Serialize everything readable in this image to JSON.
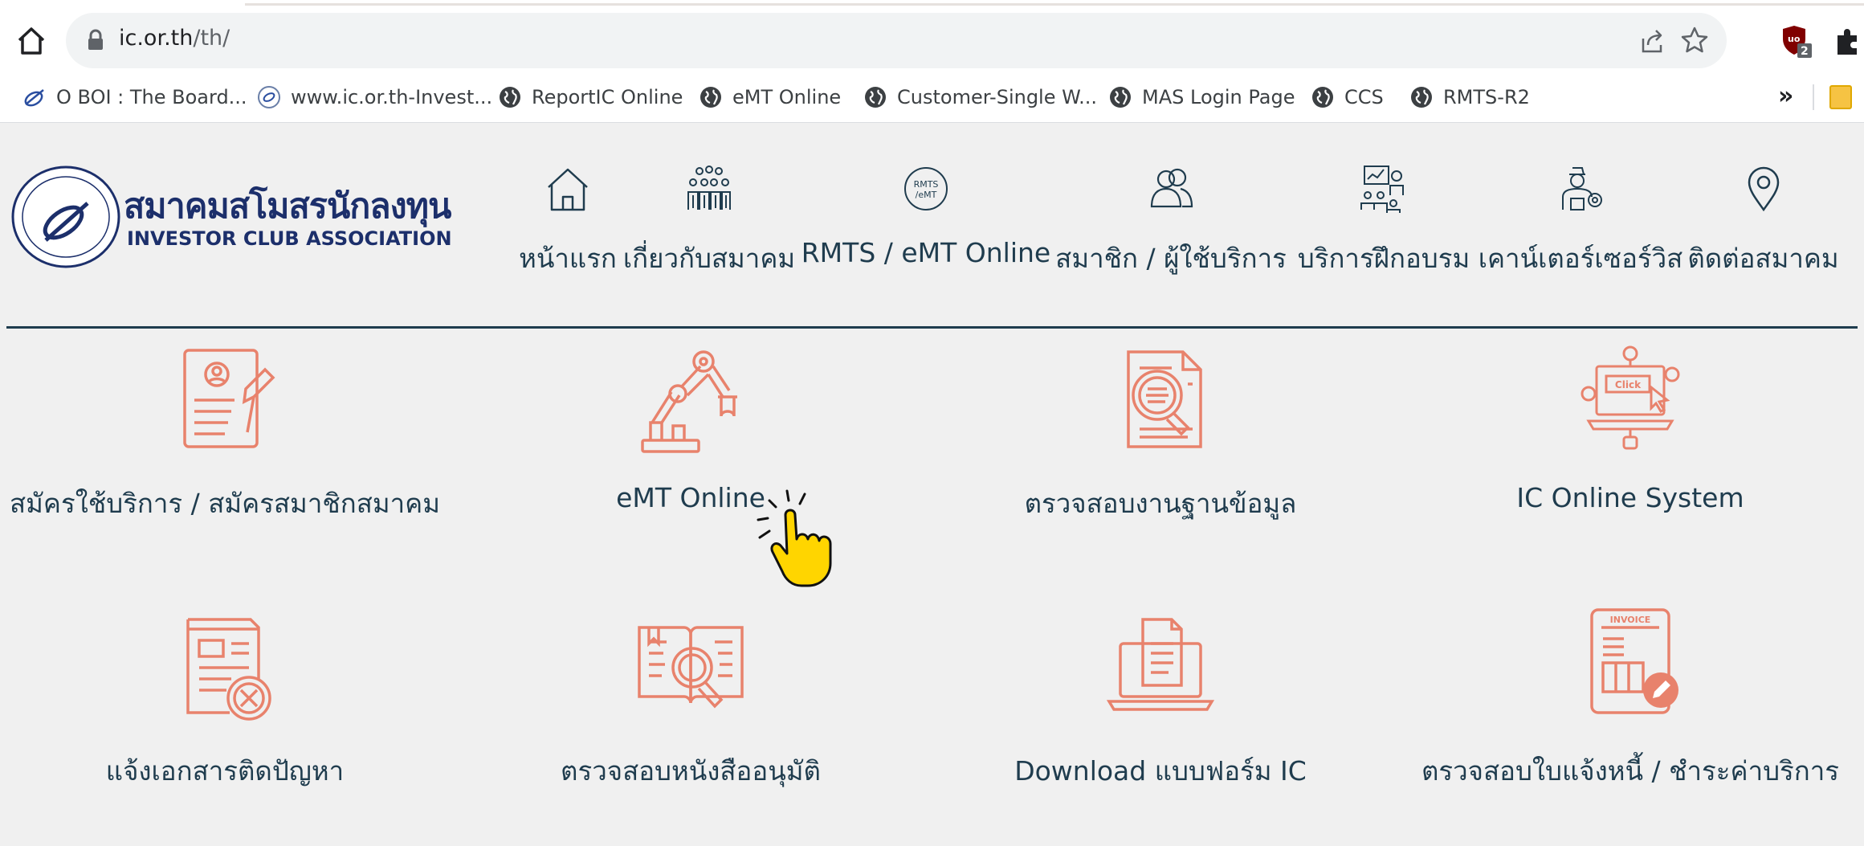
{
  "browser": {
    "url_domain": "ic.or.th",
    "url_path": "/th/",
    "extension_badge": "2",
    "bookmarks": [
      {
        "label": "O BOI : The Board...",
        "icon": "boi-icon"
      },
      {
        "label": "www.ic.or.th-Invest...",
        "icon": "ic-icon"
      },
      {
        "label": "ReportIC Online",
        "icon": "globe-icon"
      },
      {
        "label": "eMT Online",
        "icon": "globe-icon"
      },
      {
        "label": "Customer-Single W...",
        "icon": "globe-icon"
      },
      {
        "label": "MAS Login Page",
        "icon": "globe-icon"
      },
      {
        "label": "CCS",
        "icon": "globe-icon"
      },
      {
        "label": "RMTS-R2",
        "icon": "globe-icon"
      }
    ],
    "more_label": "»"
  },
  "site": {
    "logo_th": "สมาคมสโมสรนักลงทุน",
    "logo_en": "INVESTOR CLUB ASSOCIATION",
    "nav": [
      {
        "label": "หน้าแรก",
        "icon": "home-icon"
      },
      {
        "label": "เกี่ยวกับสมาคม",
        "icon": "people-group-icon"
      },
      {
        "label": "RMTS / eMT Online",
        "icon": "rmts-emt-icon",
        "icon_text": "RMTS /eMT"
      },
      {
        "label": "สมาชิก / ผู้ใช้บริการ",
        "icon": "members-icon"
      },
      {
        "label": "บริการฝึกอบรม",
        "icon": "training-icon"
      },
      {
        "label": "เคาน์เตอร์เซอร์วิส",
        "icon": "counter-service-icon"
      },
      {
        "label": "ติดต่อสมาคม",
        "icon": "location-pin-icon"
      }
    ],
    "services": [
      {
        "label": "สมัครใช้บริการ / สมัครสมาชิกสมาคม",
        "icon": "register-form-icon"
      },
      {
        "label": "eMT Online",
        "icon": "robot-arm-icon"
      },
      {
        "label": "ตรวจสอบงานฐานข้อมูล",
        "icon": "document-search-icon"
      },
      {
        "label": "IC Online System",
        "icon": "laptop-click-icon",
        "icon_text": "Click"
      },
      {
        "label": "แจ้งเอกสารติดปัญหา",
        "icon": "document-error-icon"
      },
      {
        "label": "ตรวจสอบหนังสืออนุมัติ",
        "icon": "book-search-icon"
      },
      {
        "label": "Download แบบฟอร์ม IC",
        "icon": "laptop-download-icon"
      },
      {
        "label": "ตรวจสอบใบแจ้งหนี้ / ชำระค่าบริการ",
        "icon": "invoice-icon",
        "icon_text": "INVOICE"
      }
    ]
  },
  "colors": {
    "accent": "#e8826c",
    "nav_text": "#1f3c4e",
    "logo": "#1c2f6b",
    "header_rule": "#1f3c4e"
  }
}
